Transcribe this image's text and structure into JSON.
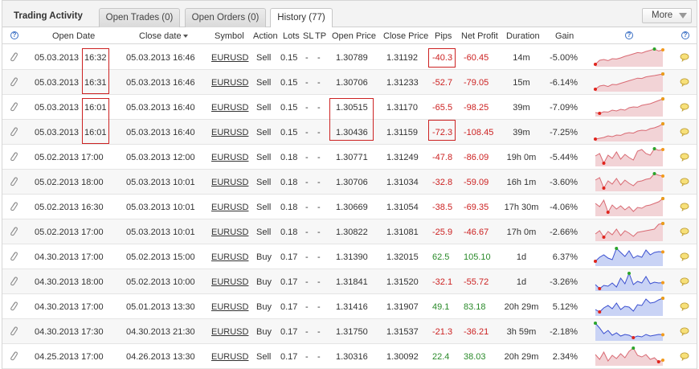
{
  "header": {
    "title": "Trading Activity",
    "tabs": [
      {
        "label": "Open Trades (0)",
        "active": false
      },
      {
        "label": "Open Orders (0)",
        "active": false
      },
      {
        "label": "History (77)",
        "active": true
      }
    ],
    "more_label": "More"
  },
  "columns": {
    "open_date": "Open Date",
    "close_date": "Close date",
    "symbol": "Symbol",
    "action": "Action",
    "lots": "Lots",
    "sl": "SL",
    "tp": "TP",
    "open_price": "Open Price",
    "close_price": "Close Price",
    "pips": "Pips",
    "net_profit": "Net Profit",
    "duration": "Duration",
    "gain": "Gain",
    "help_glyph": "?"
  },
  "colors": {
    "negative": "#cc2222",
    "positive": "#2a8a2a",
    "spark_sell_line": "#d96a73",
    "spark_sell_fill": "#f2d3d6",
    "spark_buy_line": "#3a4fd0",
    "spark_buy_fill": "#c9d3f5",
    "highlight_box": "#cc2222"
  },
  "rows": [
    {
      "open_date": "05.03.2013",
      "open_time": "16:32",
      "close_date": "05.03.2013 16:46",
      "symbol": "EURUSD",
      "action": "Sell",
      "lots": "0.15",
      "sl": "-",
      "tp": "-",
      "open_price": "1.30789",
      "close_price": "1.31192",
      "pips": "-40.3",
      "net_profit": "-60.45",
      "duration": "14m",
      "gain": "-5.00%",
      "profit": "neg",
      "spark": [
        0.05,
        0.3,
        0.35,
        0.28,
        0.4,
        0.38,
        0.45,
        0.55,
        0.62,
        0.7,
        0.78,
        0.75,
        0.85,
        0.92,
        1.0,
        0.88,
        0.95
      ]
    },
    {
      "open_date": "05.03.2013",
      "open_time": "16:31",
      "close_date": "05.03.2013 16:46",
      "symbol": "EURUSD",
      "action": "Sell",
      "lots": "0.15",
      "sl": "-",
      "tp": "-",
      "open_price": "1.30706",
      "close_price": "1.31233",
      "pips": "-52.7",
      "net_profit": "-79.05",
      "duration": "15m",
      "gain": "-6.14%",
      "profit": "neg",
      "spark": [
        0.05,
        0.25,
        0.3,
        0.22,
        0.35,
        0.33,
        0.42,
        0.5,
        0.58,
        0.66,
        0.74,
        0.72,
        0.82,
        0.86,
        0.9,
        0.95,
        1.0
      ]
    },
    {
      "open_date": "05.03.2013",
      "open_time": "16:01",
      "close_date": "05.03.2013 16:40",
      "symbol": "EURUSD",
      "action": "Sell",
      "lots": "0.15",
      "sl": "-",
      "tp": "-",
      "open_price": "1.30515",
      "close_price": "1.31170",
      "pips": "-65.5",
      "net_profit": "-98.25",
      "duration": "39m",
      "gain": "-7.09%",
      "profit": "neg",
      "spark": [
        0.15,
        0.1,
        0.2,
        0.18,
        0.3,
        0.25,
        0.35,
        0.3,
        0.45,
        0.5,
        0.48,
        0.6,
        0.65,
        0.7,
        0.8,
        0.9,
        1.0
      ]
    },
    {
      "open_date": "05.03.2013",
      "open_time": "16:01",
      "close_date": "05.03.2013 16:40",
      "symbol": "EURUSD",
      "action": "Sell",
      "lots": "0.15",
      "sl": "-",
      "tp": "-",
      "open_price": "1.30436",
      "close_price": "1.31159",
      "pips": "-72.3",
      "net_profit": "-108.45",
      "duration": "39m",
      "gain": "-7.25%",
      "profit": "neg",
      "spark": [
        0.05,
        0.1,
        0.15,
        0.25,
        0.2,
        0.3,
        0.28,
        0.4,
        0.45,
        0.42,
        0.55,
        0.6,
        0.58,
        0.7,
        0.75,
        0.85,
        1.0
      ]
    },
    {
      "open_date": "05.02.2013 17:00",
      "open_time": "",
      "close_date": "05.03.2013 12:00",
      "symbol": "EURUSD",
      "action": "Sell",
      "lots": "0.18",
      "sl": "-",
      "tp": "-",
      "open_price": "1.30771",
      "close_price": "1.31249",
      "pips": "-47.8",
      "net_profit": "-86.09",
      "duration": "19h 0m",
      "gain": "-5.44%",
      "profit": "neg",
      "spark": [
        0.55,
        0.7,
        0.1,
        0.6,
        0.4,
        0.8,
        0.35,
        0.65,
        0.45,
        0.3,
        0.85,
        0.95,
        0.7,
        0.6,
        1.0,
        0.9,
        0.95
      ]
    },
    {
      "open_date": "05.02.2013 18:00",
      "open_time": "",
      "close_date": "05.03.2013 10:01",
      "symbol": "EURUSD",
      "action": "Sell",
      "lots": "0.18",
      "sl": "-",
      "tp": "-",
      "open_price": "1.30706",
      "close_price": "1.31034",
      "pips": "-32.8",
      "net_profit": "-59.09",
      "duration": "16h 1m",
      "gain": "-3.60%",
      "profit": "neg",
      "spark": [
        0.6,
        0.75,
        0.1,
        0.55,
        0.35,
        0.7,
        0.3,
        0.6,
        0.4,
        0.25,
        0.5,
        0.55,
        0.65,
        0.7,
        1.0,
        0.9,
        0.85
      ]
    },
    {
      "open_date": "05.02.2013 16:30",
      "open_time": "",
      "close_date": "05.03.2013 10:01",
      "symbol": "EURUSD",
      "action": "Sell",
      "lots": "0.18",
      "sl": "-",
      "tp": "-",
      "open_price": "1.30669",
      "close_price": "1.31054",
      "pips": "-38.5",
      "net_profit": "-69.35",
      "duration": "17h 30m",
      "gain": "-4.06%",
      "profit": "neg",
      "spark": [
        0.7,
        0.5,
        0.9,
        0.15,
        0.6,
        0.35,
        0.55,
        0.3,
        0.5,
        0.2,
        0.45,
        0.4,
        0.55,
        0.6,
        0.7,
        0.8,
        1.0
      ]
    },
    {
      "open_date": "05.02.2013 17:00",
      "open_time": "",
      "close_date": "05.03.2013 10:01",
      "symbol": "EURUSD",
      "action": "Sell",
      "lots": "0.18",
      "sl": "-",
      "tp": "-",
      "open_price": "1.30822",
      "close_price": "1.31081",
      "pips": "-25.9",
      "net_profit": "-46.67",
      "duration": "17h 0m",
      "gain": "-2.66%",
      "profit": "neg",
      "spark": [
        0.35,
        0.55,
        0.15,
        0.5,
        0.3,
        0.65,
        0.25,
        0.55,
        0.4,
        0.2,
        0.45,
        0.5,
        0.55,
        0.6,
        0.65,
        0.95,
        1.0
      ]
    },
    {
      "open_date": "04.30.2013 17:00",
      "open_time": "",
      "close_date": "05.02.2013 15:00",
      "symbol": "EURUSD",
      "action": "Buy",
      "lots": "0.17",
      "sl": "-",
      "tp": "-",
      "open_price": "1.31390",
      "close_price": "1.32015",
      "pips": "62.5",
      "net_profit": "105.10",
      "duration": "1d",
      "gain": "6.37%",
      "profit": "pos",
      "spark": [
        0.2,
        0.45,
        0.6,
        0.4,
        0.3,
        1.0,
        0.75,
        0.5,
        0.85,
        0.4,
        0.55,
        0.45,
        0.9,
        0.6,
        0.75,
        0.8,
        0.78
      ]
    },
    {
      "open_date": "04.30.2013 18:00",
      "open_time": "",
      "close_date": "05.02.2013 10:00",
      "symbol": "EURUSD",
      "action": "Buy",
      "lots": "0.17",
      "sl": "-",
      "tp": "-",
      "open_price": "1.31841",
      "close_price": "1.31520",
      "pips": "-32.1",
      "net_profit": "-55.72",
      "duration": "1d",
      "gain": "-3.26%",
      "profit": "neg",
      "spark": [
        0.3,
        0.05,
        0.25,
        0.2,
        0.4,
        0.15,
        0.7,
        0.35,
        1.0,
        0.3,
        0.5,
        0.4,
        0.8,
        0.35,
        0.45,
        0.4,
        0.42
      ]
    },
    {
      "open_date": "04.30.2013 17:00",
      "open_time": "",
      "close_date": "05.01.2013 13:30",
      "symbol": "EURUSD",
      "action": "Buy",
      "lots": "0.17",
      "sl": "-",
      "tp": "-",
      "open_price": "1.31416",
      "close_price": "1.31907",
      "pips": "49.1",
      "net_profit": "83.18",
      "duration": "20h 29m",
      "gain": "5.12%",
      "profit": "pos",
      "spark": [
        0.3,
        0.15,
        0.4,
        0.55,
        0.35,
        0.7,
        0.3,
        0.5,
        0.45,
        0.2,
        0.6,
        0.55,
        0.95,
        0.7,
        0.75,
        0.9,
        1.0
      ]
    },
    {
      "open_date": "04.30.2013 17:30",
      "open_time": "",
      "close_date": "04.30.2013 21:30",
      "symbol": "EURUSD",
      "action": "Buy",
      "lots": "0.17",
      "sl": "-",
      "tp": "-",
      "open_price": "1.31750",
      "close_price": "1.31537",
      "pips": "-21.3",
      "net_profit": "-36.21",
      "duration": "3h 59m",
      "gain": "-2.18%",
      "profit": "neg",
      "spark": [
        1.0,
        0.7,
        0.35,
        0.55,
        0.25,
        0.4,
        0.2,
        0.3,
        0.25,
        0.1,
        0.2,
        0.15,
        0.3,
        0.2,
        0.25,
        0.3,
        0.28
      ]
    },
    {
      "open_date": "04.25.2013 17:00",
      "open_time": "",
      "close_date": "04.26.2013 13:30",
      "symbol": "EURUSD",
      "action": "Sell",
      "lots": "0.17",
      "sl": "-",
      "tp": "-",
      "open_price": "1.30316",
      "close_price": "1.30092",
      "pips": "22.4",
      "net_profit": "38.03",
      "duration": "20h 29m",
      "gain": "2.34%",
      "profit": "pos",
      "spark": [
        0.6,
        0.3,
        0.75,
        0.2,
        0.55,
        0.35,
        0.65,
        0.4,
        0.8,
        1.0,
        0.55,
        0.45,
        0.6,
        0.3,
        0.4,
        0.15,
        0.25
      ]
    }
  ]
}
